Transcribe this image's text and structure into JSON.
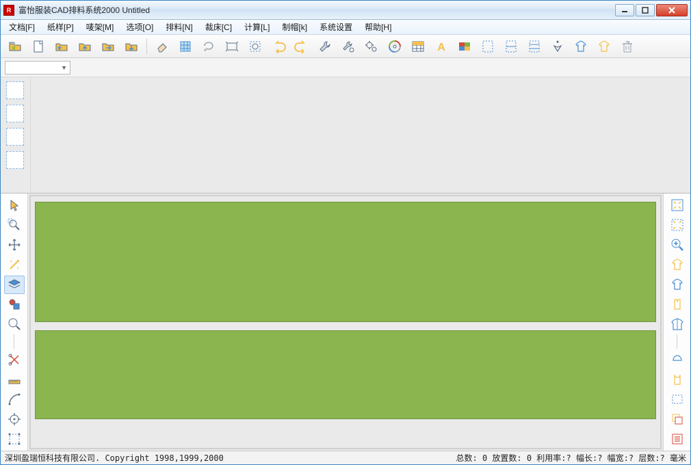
{
  "window": {
    "title": "富怡服装CAD排料系统2000 Untitled"
  },
  "menu": {
    "items": [
      "文档[F]",
      "纸样[P]",
      "唛架[M]",
      "选项[O]",
      "排料[N]",
      "裁床[C]",
      "计算[L]",
      "制帽[k]",
      "系统设置",
      "帮助[H]"
    ]
  },
  "toolbar": {
    "items": [
      "open-folder",
      "new-doc",
      "folder-left",
      "folder-up",
      "folder-right",
      "folder-down",
      "sep",
      "eraser",
      "grid-tool",
      "lasso",
      "frame",
      "crop-rect",
      "undo",
      "redo",
      "wrench",
      "wrench-gear",
      "gears",
      "cd-disc",
      "table-grid",
      "text-a",
      "palette",
      "page-dashed-1",
      "page-dashed-2",
      "page-dashed-3",
      "compass",
      "shirt-left",
      "shirt-right",
      "trash"
    ]
  },
  "combo": {
    "value": ""
  },
  "leftTools": [
    "pointer",
    "zoom-area",
    "move",
    "wand",
    "layers",
    "shapes",
    "magnifier",
    "sep",
    "scissors-x",
    "ruler",
    "arc-tool",
    "snap-target",
    "edit-node"
  ],
  "rightTools": [
    "fit-screen",
    "zoom-extents",
    "zoom",
    "shirt-front",
    "shirt-back",
    "vest",
    "jacket",
    "sep",
    "collar",
    "bodice",
    "rect-dashed",
    "copy-piece",
    "piece-list"
  ],
  "status": {
    "left": "深圳盈瑞恒科技有限公司. Copyright 1998,1999,2000",
    "right": "总数: 0 放置数: 0 利用率:? 幅长:? 幅宽:? 层数:? 毫米"
  },
  "colors": {
    "marker": "#8ab54f",
    "accent": "#3a84c2"
  }
}
